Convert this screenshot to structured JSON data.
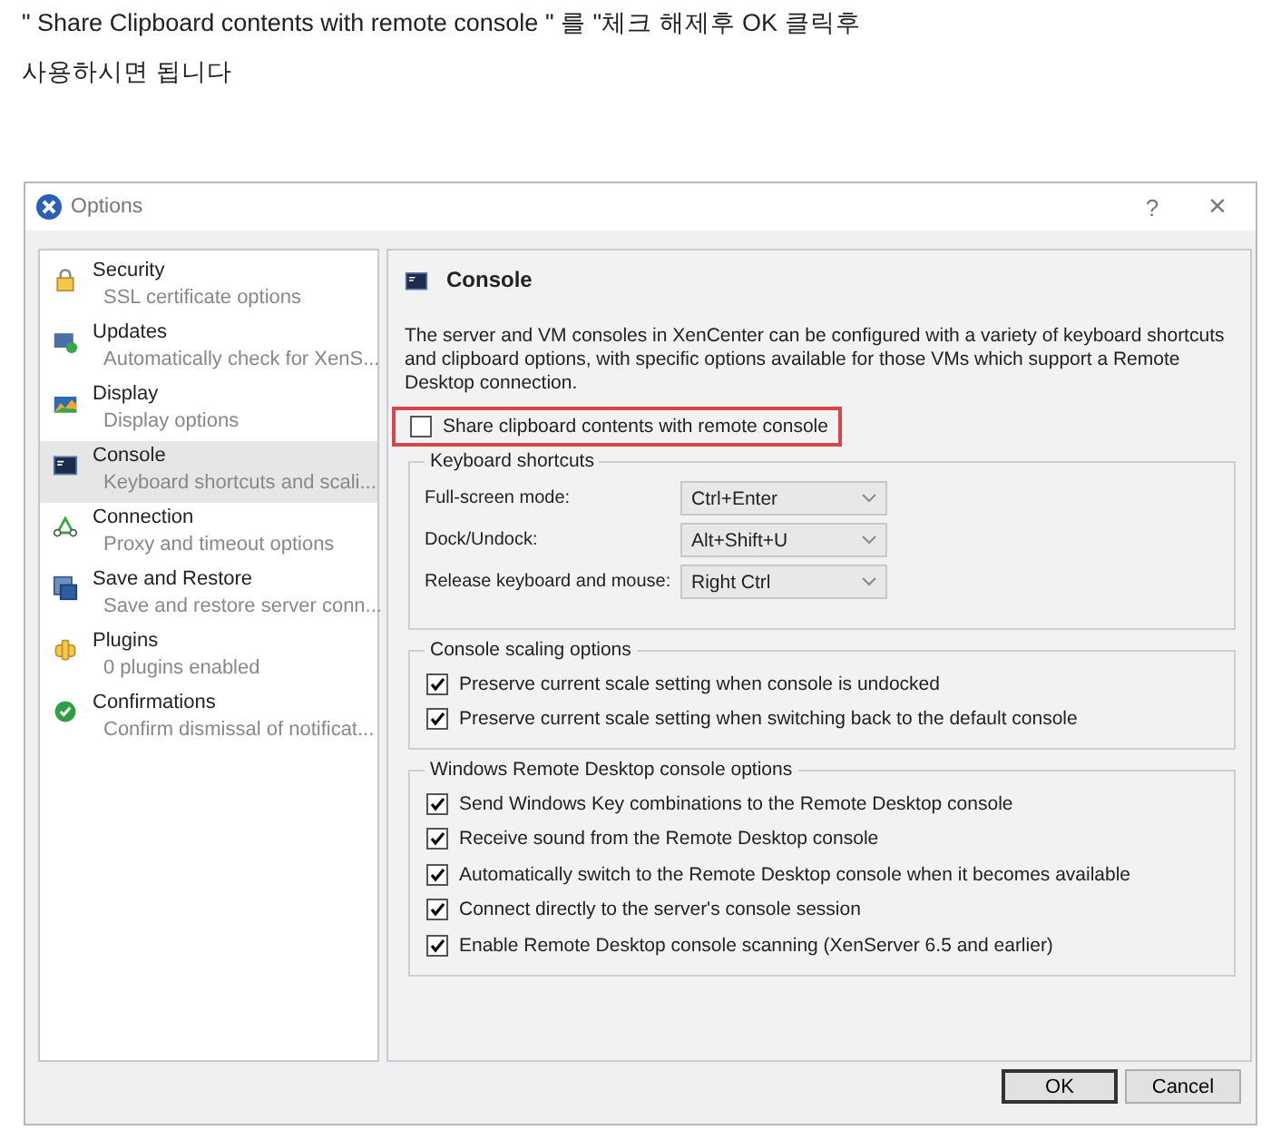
{
  "intro": [
    "\" Share Clipboard contents with remote console \" 를  \"체크 해제후 OK 클릭후",
    "사용하시면 됩니다"
  ],
  "window": {
    "title": "Options",
    "help": "?",
    "close": "×"
  },
  "sidebar": {
    "items": [
      {
        "title": "Security",
        "subtitle": "SSL certificate options",
        "selected": false
      },
      {
        "title": "Updates",
        "subtitle": "Automatically check for XenS...",
        "selected": false
      },
      {
        "title": "Display",
        "subtitle": "Display options",
        "selected": false
      },
      {
        "title": "Console",
        "subtitle": "Keyboard shortcuts and scali...",
        "selected": true
      },
      {
        "title": "Connection",
        "subtitle": "Proxy and timeout options",
        "selected": false
      },
      {
        "title": "Save and Restore",
        "subtitle": "Save and restore server conn...",
        "selected": false
      },
      {
        "title": "Plugins",
        "subtitle": "0 plugins enabled",
        "selected": false
      },
      {
        "title": "Confirmations",
        "subtitle": "Confirm dismissal of notificat...",
        "selected": false
      }
    ]
  },
  "panel": {
    "title": "Console",
    "description": "The server and VM consoles in XenCenter can be configured with a variety of keyboard shortcuts and clipboard options, with specific options available for those VMs which support a Remote Desktop connection.",
    "share_clipboard": {
      "label": "Share clipboard contents with remote console",
      "checked": false,
      "highlighted": true
    },
    "keyboard_shortcuts": {
      "title": "Keyboard shortcuts",
      "rows": [
        {
          "label": "Full-screen mode:",
          "value": "Ctrl+Enter"
        },
        {
          "label": "Dock/Undock:",
          "value": "Alt+Shift+U"
        },
        {
          "label": "Release keyboard and mouse:",
          "value": "Right Ctrl"
        }
      ]
    },
    "groups": [
      {
        "title": "Console scaling options",
        "options": [
          {
            "label": "Preserve current scale setting when console is undocked",
            "checked": true
          },
          {
            "label": "Preserve current scale setting when switching back to the default console",
            "checked": true
          }
        ]
      },
      {
        "title": "Windows Remote Desktop console options",
        "options": [
          {
            "label": "Send Windows Key combinations to the Remote Desktop console",
            "checked": true
          },
          {
            "label": "Receive sound from the Remote Desktop console",
            "checked": true
          },
          {
            "label": "Automatically switch to the Remote Desktop console when it becomes available",
            "checked": true
          },
          {
            "label": "Connect directly to the server's console session",
            "checked": true
          },
          {
            "label": "Enable Remote Desktop console scanning (XenServer 6.5 and earlier)",
            "checked": true
          }
        ]
      }
    ]
  },
  "buttons": [
    "OK",
    "Cancel"
  ]
}
